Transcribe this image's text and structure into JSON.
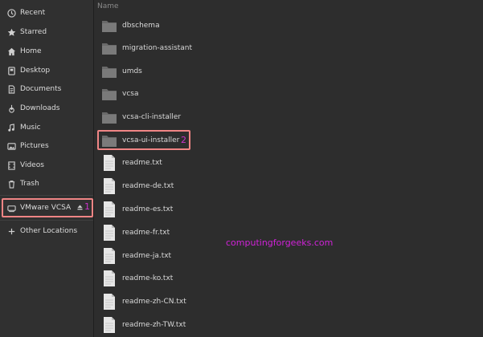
{
  "sidebar": {
    "items": [
      {
        "label": "Recent",
        "icon": "clock-icon"
      },
      {
        "label": "Starred",
        "icon": "star-icon"
      },
      {
        "label": "Home",
        "icon": "home-icon"
      },
      {
        "label": "Desktop",
        "icon": "desktop-icon"
      },
      {
        "label": "Documents",
        "icon": "document-icon"
      },
      {
        "label": "Downloads",
        "icon": "download-icon"
      },
      {
        "label": "Music",
        "icon": "music-icon"
      },
      {
        "label": "Pictures",
        "icon": "picture-icon"
      },
      {
        "label": "Videos",
        "icon": "video-icon"
      },
      {
        "label": "Trash",
        "icon": "trash-icon"
      }
    ],
    "mounted": {
      "label": "VMware VCSA",
      "icon": "drive-icon",
      "eject_icon": "eject-icon",
      "step": "1"
    },
    "other": {
      "label": "Other Locations",
      "icon": "plus-icon"
    }
  },
  "content": {
    "column_header": "Name",
    "folders": [
      "dbschema",
      "migration-assistant",
      "umds",
      "vcsa",
      "vcsa-cli-installer",
      "vcsa-ui-installer"
    ],
    "highlighted_folder_step": "2",
    "files": [
      "readme.txt",
      "readme-de.txt",
      "readme-es.txt",
      "readme-fr.txt",
      "readme-ja.txt",
      "readme-ko.txt",
      "readme-zh-CN.txt",
      "readme-zh-TW.txt"
    ]
  },
  "watermark": "computingforgeeks.com",
  "colors": {
    "highlight": "#f08585",
    "annotation": "#cc33cc",
    "watermark": "#d022d8"
  }
}
